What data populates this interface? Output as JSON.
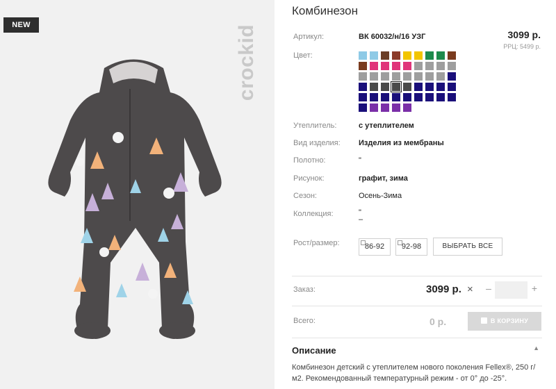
{
  "badge": {
    "new": "NEW"
  },
  "brand": {
    "logo_text": "crockid"
  },
  "product": {
    "title": "Комбинезон",
    "price": "3099 р.",
    "rrc": "РРЦ: 5499 р."
  },
  "labels": {
    "article": "Артикул:",
    "color": "Цвет:",
    "insulation": "Утеплитель:",
    "type": "Вид изделия:",
    "fabric": "Полотно:",
    "pattern": "Рисунок:",
    "season": "Сезон:",
    "collection": "Коллекция:",
    "size": "Рост/размер:",
    "order": "Заказ:",
    "total": "Всего:"
  },
  "values": {
    "article": "ВК 60032/н/16 УЗГ",
    "insulation": "с утеплителем",
    "type": "Изделия из мембраны",
    "fabric": "\"",
    "pattern": "графит, зима",
    "season": "Осень-Зима",
    "collection": "\"",
    "collection_extra": "–"
  },
  "colors": [
    [
      "#8ecae6",
      "#8ecae6",
      "#6b3e26",
      "#8c3b2a",
      "#f2c500",
      "#f2c500",
      "#1e8a4c",
      "#1e8a4c",
      "#7a3b1e"
    ],
    [
      "#7a3b1e",
      "#e0347a",
      "#e0347a",
      "#e0347a",
      "#e0347a",
      "#9e9e9e",
      "#9e9e9e",
      "#9e9e9e",
      "#9e9e9e"
    ],
    [
      "#9e9e9e",
      "#9e9e9e",
      "#9e9e9e",
      "#9e9e9e",
      "#9e9e9e",
      "#9e9e9e",
      "#9e9e9e",
      "#9e9e9e",
      "#1a0f7a"
    ],
    [
      "#1a0f7a",
      "#4a4a4a",
      "#4a4a4a",
      "#4a4a4a",
      "#4a4a4a",
      "#1a0f7a",
      "#1a0f7a",
      "#1a0f7a",
      "#1a0f7a"
    ],
    [
      "#1a0f7a",
      "#1a0f7a",
      "#1a0f7a",
      "#1a0f7a",
      "#1a0f7a",
      "#1a0f7a",
      "#1a0f7a",
      "#1a0f7a",
      "#1a0f7a"
    ],
    [
      "#1a0f7a",
      "#7a2fa8",
      "#7a2fa8",
      "#7a2fa8",
      "#7a2fa8"
    ]
  ],
  "selected_color": {
    "row": 3,
    "col": 3
  },
  "sizes": [
    "86-92",
    "92-98"
  ],
  "select_all": "ВЫБРАТЬ ВСЕ",
  "order": {
    "price": "3099 р.",
    "times": "×",
    "minus": "–",
    "plus": "+",
    "quantity": ""
  },
  "total": {
    "value": "0 р.",
    "cart_button": "В КОРЗИНУ"
  },
  "description": {
    "title": "Описание",
    "caret": "▲",
    "text": "Комбинезон детский с утеплителем нового поколения Fellex®, 250 г/м2. Рекомендованный температурный режим - от 0° до -25°."
  }
}
